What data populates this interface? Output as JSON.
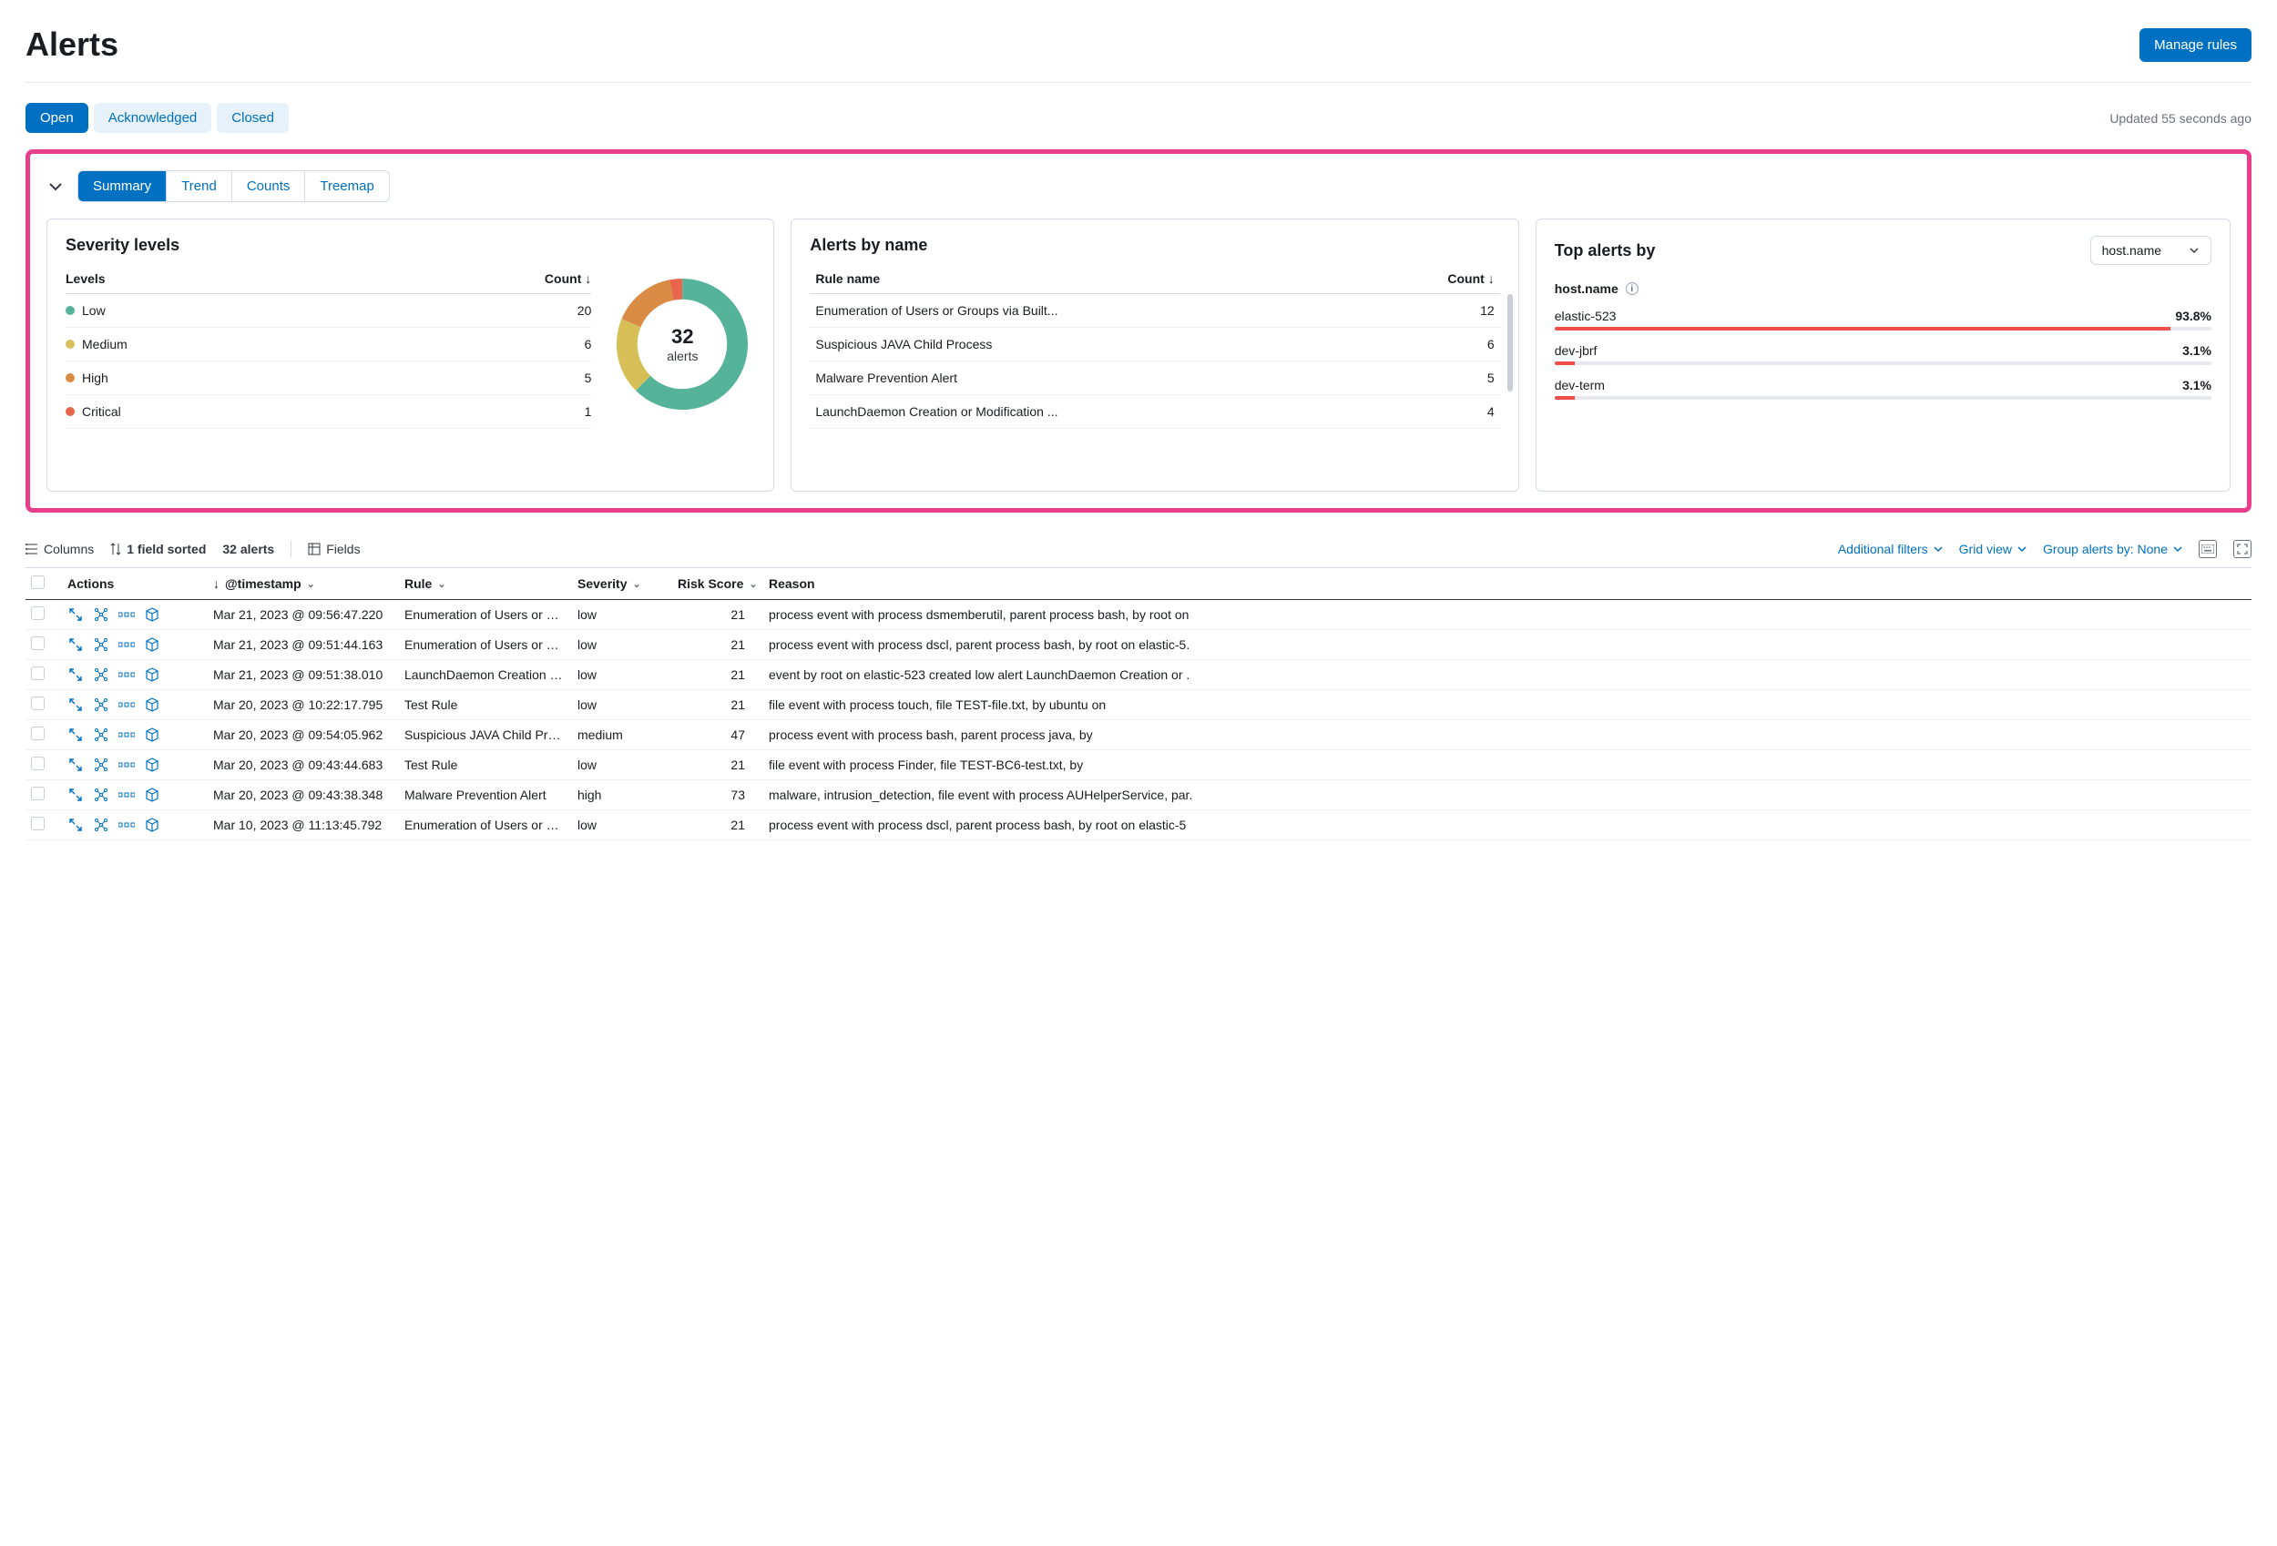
{
  "header": {
    "title": "Alerts",
    "manage_rules": "Manage rules"
  },
  "status_tabs": {
    "open": "Open",
    "acknowledged": "Acknowledged",
    "closed": "Closed",
    "active": "open"
  },
  "updated": "Updated 55 seconds ago",
  "view_tabs": {
    "summary": "Summary",
    "trend": "Trend",
    "counts": "Counts",
    "treemap": "Treemap",
    "active": "summary"
  },
  "severity_panel": {
    "title": "Severity levels",
    "levels_header": "Levels",
    "count_header": "Count",
    "rows": [
      {
        "label": "Low",
        "count": 20,
        "color": "#54b399"
      },
      {
        "label": "Medium",
        "count": 6,
        "color": "#d6bf57"
      },
      {
        "label": "High",
        "count": 5,
        "color": "#e7664c"
      },
      {
        "label": "Critical",
        "count": 1,
        "color": "#e7664c"
      }
    ],
    "total": 32,
    "total_label": "alerts"
  },
  "chart_data": {
    "type": "pie",
    "title": "Severity levels",
    "series": [
      {
        "name": "Low",
        "value": 20,
        "color": "#54b399"
      },
      {
        "name": "Medium",
        "value": 6,
        "color": "#d6bf57"
      },
      {
        "name": "High",
        "value": 5,
        "color": "#da8b45"
      },
      {
        "name": "Critical",
        "value": 1,
        "color": "#e7664c"
      }
    ],
    "total": 32
  },
  "alerts_by_name": {
    "title": "Alerts by name",
    "rule_header": "Rule name",
    "count_header": "Count",
    "rows": [
      {
        "name": "Enumeration of Users or Groups via Built...",
        "count": 12
      },
      {
        "name": "Suspicious JAVA Child Process",
        "count": 6
      },
      {
        "name": "Malware Prevention Alert",
        "count": 5
      },
      {
        "name": "LaunchDaemon Creation or Modification ...",
        "count": 4
      }
    ]
  },
  "top_alerts": {
    "title": "Top alerts by",
    "field_selected": "host.name",
    "field_label": "host.name",
    "rows": [
      {
        "name": "elastic-523",
        "pct": "93.8%",
        "width": 93.8
      },
      {
        "name": "dev-jbrf",
        "pct": "3.1%",
        "width": 3.1
      },
      {
        "name": "dev-term",
        "pct": "3.1%",
        "width": 3.1
      }
    ]
  },
  "toolbar": {
    "columns": "Columns",
    "sorted": "1 field sorted",
    "count": "32 alerts",
    "fields": "Fields",
    "additional_filters": "Additional filters",
    "grid_view": "Grid view",
    "group_by": "Group alerts by: None"
  },
  "table": {
    "headers": {
      "actions": "Actions",
      "timestamp": "@timestamp",
      "rule": "Rule",
      "severity": "Severity",
      "risk": "Risk Score",
      "reason": "Reason"
    },
    "rows": [
      {
        "ts": "Mar 21, 2023 @ 09:56:47.220",
        "rule": "Enumeration of Users or Gr...",
        "sev": "low",
        "risk": 21,
        "reason": "process event with process dsmemberutil, parent process bash, by root on"
      },
      {
        "ts": "Mar 21, 2023 @ 09:51:44.163",
        "rule": "Enumeration of Users or Gr...",
        "sev": "low",
        "risk": 21,
        "reason": "process event with process dscl, parent process bash, by root on elastic-5."
      },
      {
        "ts": "Mar 21, 2023 @ 09:51:38.010",
        "rule": "LaunchDaemon Creation or...",
        "sev": "low",
        "risk": 21,
        "reason": "event by root on elastic-523 created low alert LaunchDaemon Creation or ."
      },
      {
        "ts": "Mar 20, 2023 @ 10:22:17.795",
        "rule": "Test Rule",
        "sev": "low",
        "risk": 21,
        "reason": "file event with process touch, file TEST-file.txt, by ubuntu on"
      },
      {
        "ts": "Mar 20, 2023 @ 09:54:05.962",
        "rule": "Suspicious JAVA Child Proc...",
        "sev": "medium",
        "risk": 47,
        "reason": "process event with process bash, parent process java, by"
      },
      {
        "ts": "Mar 20, 2023 @ 09:43:44.683",
        "rule": "Test Rule",
        "sev": "low",
        "risk": 21,
        "reason": "file event with process Finder, file TEST-BC6-test.txt, by"
      },
      {
        "ts": "Mar 20, 2023 @ 09:43:38.348",
        "rule": "Malware Prevention Alert",
        "sev": "high",
        "risk": 73,
        "reason": "malware, intrusion_detection, file event with process AUHelperService, par."
      },
      {
        "ts": "Mar 10, 2023 @ 11:13:45.792",
        "rule": "Enumeration of Users or Gr...",
        "sev": "low",
        "risk": 21,
        "reason": "process event with process dscl, parent process bash, by root on elastic-5"
      }
    ]
  }
}
